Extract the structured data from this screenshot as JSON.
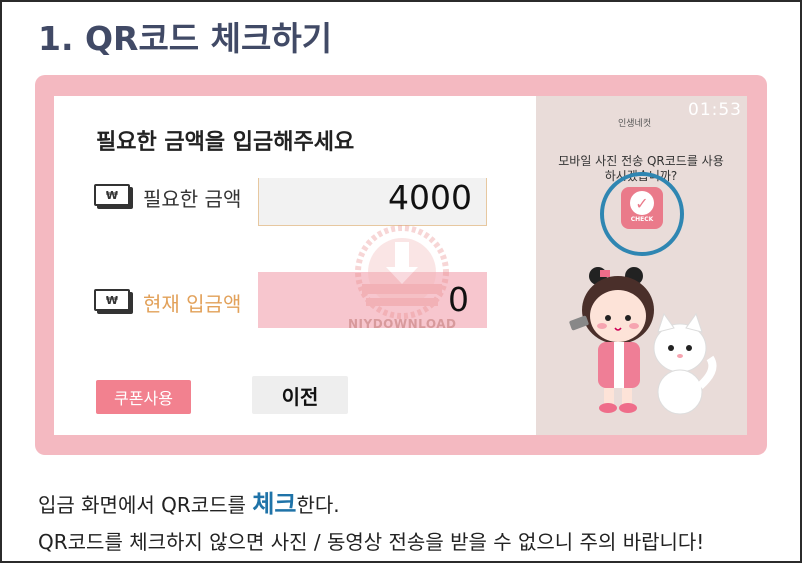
{
  "heading": "1. QR코드 체크하기",
  "left_panel": {
    "prompt": "필요한 금액을 입금해주세요",
    "currency_icon": "₩",
    "need_label": "필요한 금액",
    "need_value": "4000",
    "current_label": "현재 입금액",
    "current_value": "0",
    "coupon_button": "쿠폰사용",
    "prev_button": "이전"
  },
  "right_panel": {
    "timer": "01:53",
    "brand": "인생네컷",
    "question": "모바일 사진 전송 QR코드를 사용하시겠습니까?",
    "check_label": "CHECK"
  },
  "watermark_text": "NIYDOWNLOAD",
  "description": {
    "line1_before": "입금 화면에서 QR코드를 ",
    "line1_highlight": "체크",
    "line1_after": "한다.",
    "line2": "QR코드를 체크하지 않으면 사진 / 동영상 전송을 받을 수 없으니 주의 바랍니다!"
  },
  "colors": {
    "outer_border": "#f4b9c1",
    "accent_pink": "#f2818f",
    "highlight_blue": "#1f73a8",
    "heading": "#414a66"
  }
}
